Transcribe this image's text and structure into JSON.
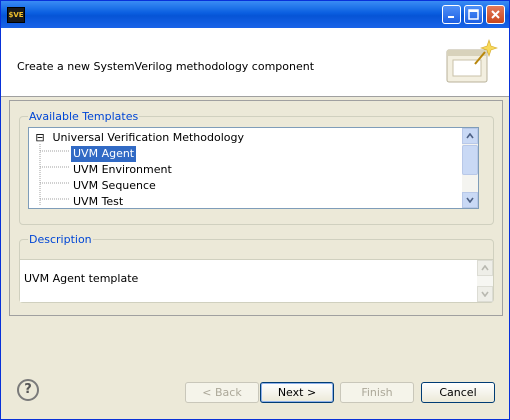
{
  "window": {
    "app_icon_text": "$VE"
  },
  "header": {
    "message": "Create a new SystemVerilog methodology component"
  },
  "templates": {
    "group_title": "Available Templates",
    "root": {
      "label": "Universal Verification Methodology",
      "expand_symbol": "⊟"
    },
    "items": [
      "UVM Agent",
      "UVM Environment",
      "UVM Sequence",
      "UVM Test"
    ],
    "selected": "UVM Agent"
  },
  "description": {
    "group_title": "Description",
    "text": "UVM Agent template"
  },
  "buttons": {
    "back": "< Back",
    "next": "Next >",
    "finish": "Finish",
    "cancel": "Cancel",
    "help": "?"
  },
  "colors": {
    "accent": "#0046d5",
    "selection": "#316ac5",
    "titlebar": "#0a5ee0"
  }
}
